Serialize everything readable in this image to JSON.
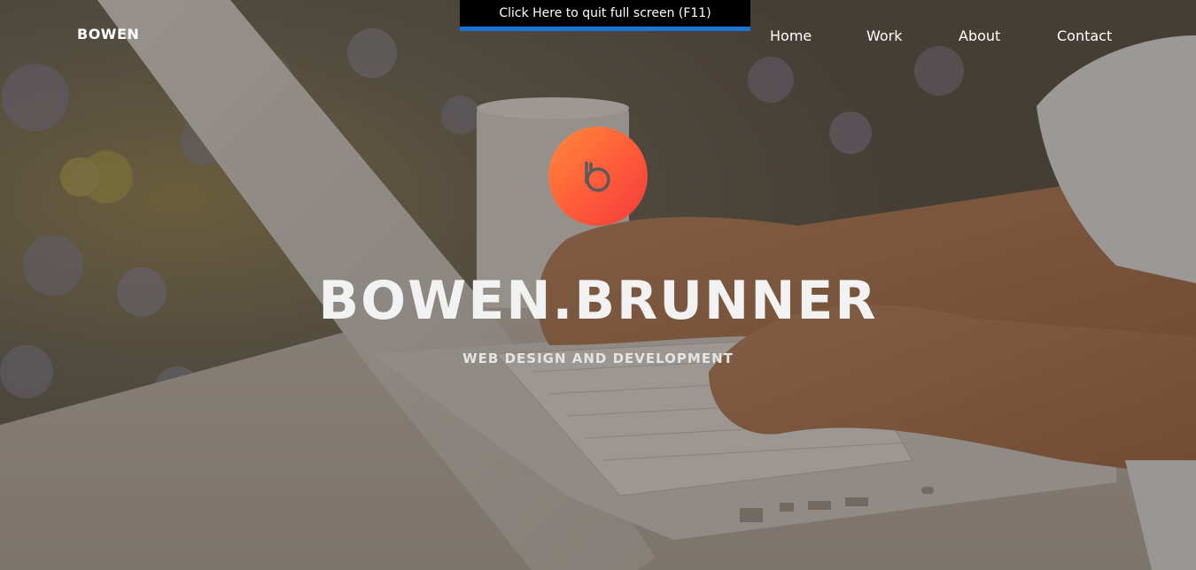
{
  "fullscreen_banner": {
    "text": "Click Here to quit full screen (F11)"
  },
  "header": {
    "brand": "BOWEN",
    "nav": [
      {
        "label": "Home"
      },
      {
        "label": "Work"
      },
      {
        "label": "About"
      },
      {
        "label": "Contact"
      }
    ]
  },
  "hero": {
    "logo_icon": "b-monogram-icon",
    "title": "BOWEN.BRUNNER",
    "subtitle": "WEB DESIGN AND DEVELOPMENT"
  },
  "colors": {
    "logo_gradient_start": "#ff8a3c",
    "logo_gradient_end": "#f23a3a",
    "banner_background": "#000000",
    "banner_border": "#1a73d9",
    "text": "#ffffff"
  }
}
